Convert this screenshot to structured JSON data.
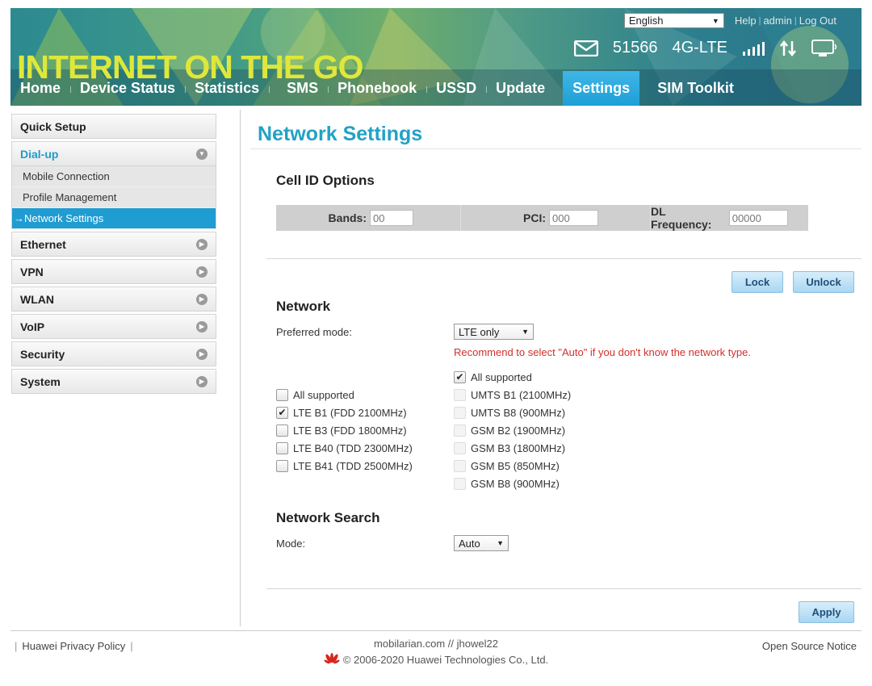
{
  "header": {
    "brand": "INTERNET ON THE GO",
    "language": "English",
    "links": [
      "Help",
      "admin",
      "Log Out"
    ],
    "message_count": "51566",
    "network_type": "4G-LTE",
    "accent_color": "#1f9cd1",
    "brand_color": "#dfe73a",
    "icons": [
      "envelope-icon",
      "signal-bars-icon",
      "updown-arrows-icon",
      "monitor-icon"
    ]
  },
  "nav": {
    "items": [
      "Home",
      "Device Status",
      "Statistics",
      "SMS",
      "Phonebook",
      "USSD",
      "Update",
      "Settings",
      "SIM Toolkit"
    ],
    "active": "Settings"
  },
  "sidebar": {
    "quick_setup": "Quick Setup",
    "dialup": "Dial-up",
    "dialup_sub": [
      "Mobile Connection",
      "Profile Management",
      "Network Settings"
    ],
    "active_sub": "Network Settings",
    "others": [
      "Ethernet",
      "VPN",
      "WLAN",
      "VoIP",
      "Security",
      "System"
    ]
  },
  "main": {
    "title": "Network Settings",
    "cell_id": {
      "heading": "Cell ID Options",
      "bands_label": "Bands:",
      "bands_value": "00",
      "pci_label": "PCI:",
      "pci_value": "000",
      "dl_label": "DL Frequency:",
      "dl_value": "00000"
    },
    "lock_label": "Lock",
    "unlock_label": "Unlock",
    "network": {
      "heading": "Network",
      "preferred_label": "Preferred mode:",
      "preferred_value": "LTE only",
      "warning": "Recommend to select \"Auto\" if you don't know the network type.",
      "left_bands": [
        {
          "label": "All supported",
          "checked": false
        },
        {
          "label": "LTE B1 (FDD 2100MHz)",
          "checked": true
        },
        {
          "label": "LTE B3 (FDD 1800MHz)",
          "checked": false
        },
        {
          "label": "LTE B40 (TDD 2300MHz)",
          "checked": false
        },
        {
          "label": "LTE B41 (TDD 2500MHz)",
          "checked": false
        }
      ],
      "right_bands": [
        {
          "label": "All supported",
          "checked": true
        },
        {
          "label": "UMTS B1 (2100MHz)",
          "checked": false
        },
        {
          "label": "UMTS B8 (900MHz)",
          "checked": false
        },
        {
          "label": "GSM B2 (1900MHz)",
          "checked": false
        },
        {
          "label": "GSM B3 (1800MHz)",
          "checked": false
        },
        {
          "label": "GSM B5 (850MHz)",
          "checked": false
        },
        {
          "label": "GSM B8 (900MHz)",
          "checked": false
        }
      ]
    },
    "search": {
      "heading": "Network Search",
      "mode_label": "Mode:",
      "mode_value": "Auto"
    },
    "apply_label": "Apply"
  },
  "footer": {
    "privacy": "Huawei Privacy Policy",
    "credit": "mobilarian.com // jhowel22",
    "copyright": "© 2006-2020 Huawei Technologies Co., Ltd.",
    "open_source": "Open Source Notice"
  }
}
